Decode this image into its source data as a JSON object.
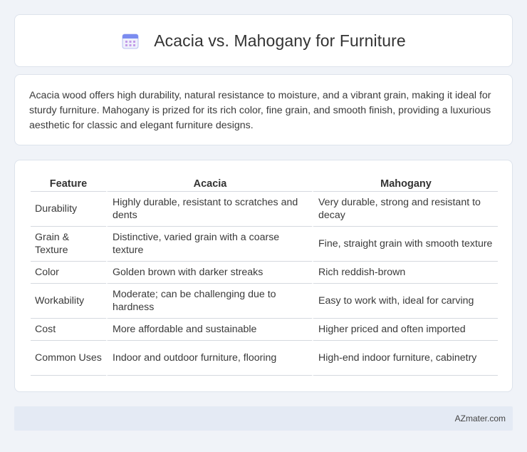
{
  "header": {
    "title": "Acacia vs. Mahogany for Furniture",
    "icon": "calendar-icon"
  },
  "summary": {
    "text": "Acacia wood offers high durability, natural resistance to moisture, and a vibrant grain, making it ideal for sturdy furniture. Mahogany is prized for its rich color, fine grain, and smooth finish, providing a luxurious aesthetic for classic and elegant furniture designs."
  },
  "table": {
    "headers": [
      "Feature",
      "Acacia",
      "Mahogany"
    ],
    "rows": [
      [
        "Durability",
        "Highly durable, resistant to scratches and dents",
        "Very durable, strong and resistant to decay"
      ],
      [
        "Grain & Texture",
        "Distinctive, varied grain with a coarse texture",
        "Fine, straight grain with smooth texture"
      ],
      [
        "Color",
        "Golden brown with darker streaks",
        "Rich reddish-brown"
      ],
      [
        "Workability",
        "Moderate; can be challenging due to hardness",
        "Easy to work with, ideal for carving"
      ],
      [
        "Cost",
        "More affordable and sustainable",
        "Higher priced and often imported"
      ],
      [
        "Common Uses",
        "Indoor and outdoor furniture, flooring",
        "High-end indoor furniture, cabinetry"
      ]
    ]
  },
  "footer": {
    "brand": "AZmater.com"
  },
  "colors": {
    "background": "#f0f3f8",
    "card": "#ffffff",
    "footer_bg": "#e4eaf4",
    "icon_accent": "#7b8cf0"
  }
}
